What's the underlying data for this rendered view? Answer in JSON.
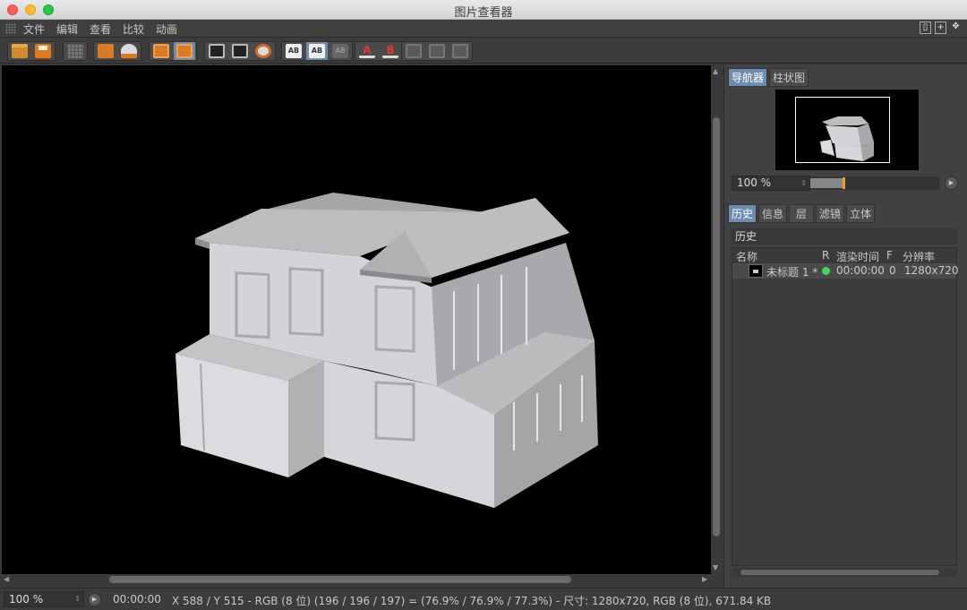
{
  "window": {
    "title": "图片查看器"
  },
  "menu": {
    "items": [
      "文件",
      "编辑",
      "查看",
      "比较",
      "动画"
    ]
  },
  "navigator": {
    "tabs": [
      "导航器",
      "柱状图"
    ],
    "zoom": "100 %",
    "zoom_level_fraction": 0.25
  },
  "panel": {
    "tabs": [
      "历史",
      "信息",
      "层",
      "滤镜",
      "立体"
    ],
    "section_title": "历史",
    "columns": [
      "名称",
      "R",
      "渲染时间",
      "F",
      "分辨率"
    ],
    "rows": [
      {
        "name": "未标题 1 *",
        "status_color": "#43d65a",
        "time": "00:00:00",
        "frame": "0",
        "resolution": "1280x720"
      }
    ]
  },
  "status": {
    "zoom": "100 %",
    "time": "00:00:00",
    "info": "X 588 / Y 515 - RGB (8 位) (196 / 196 / 197) = (76.9% / 76.9% / 77.3%) - 尺寸: 1280x720, RGB (8 位), 671.84 KB"
  },
  "colors": {
    "accent": "#6e8cae",
    "orange": "#d97a24",
    "status_green": "#43d65a",
    "viewport_bg": "#000000"
  }
}
